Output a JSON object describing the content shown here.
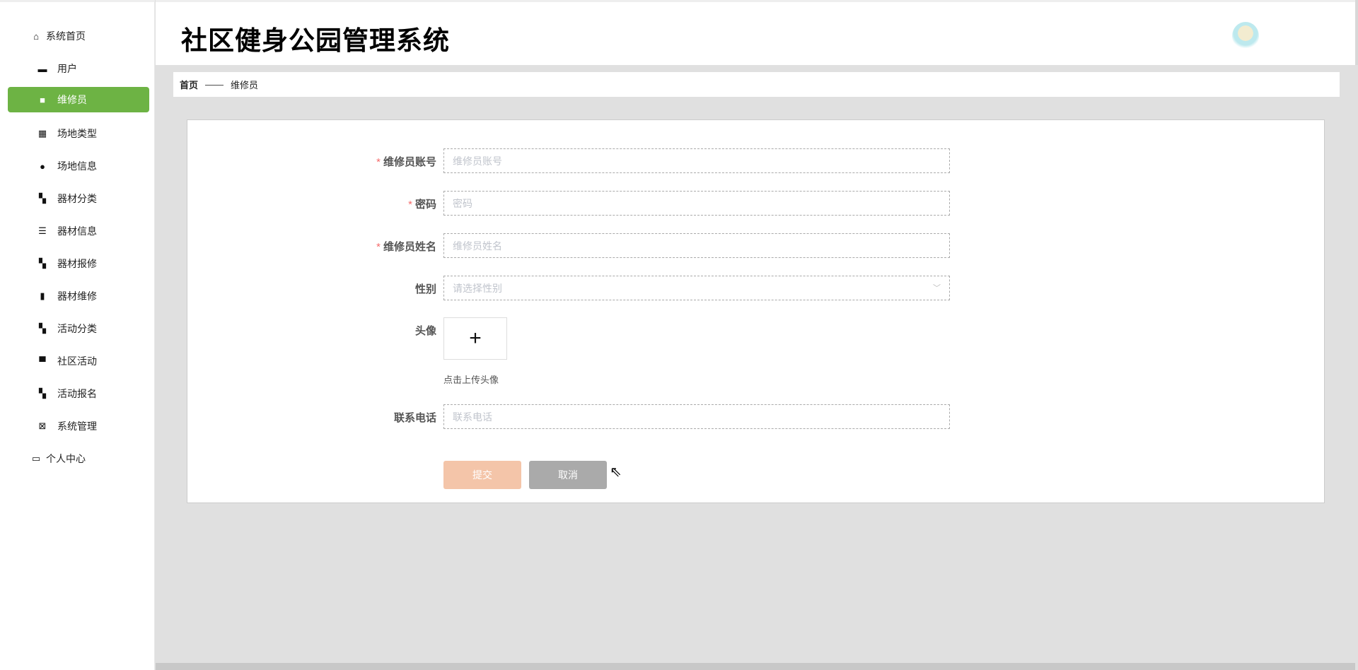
{
  "header": {
    "title": "社区健身公园管理系统"
  },
  "sidebar": {
    "items": [
      {
        "label": "系统首页",
        "icon": "home-icon"
      },
      {
        "label": "用户",
        "icon": "user-icon"
      },
      {
        "label": "维修员",
        "icon": "briefcase-icon"
      },
      {
        "label": "场地类型",
        "icon": "grid-icon"
      },
      {
        "label": "场地信息",
        "icon": "bulb-icon"
      },
      {
        "label": "器材分类",
        "icon": "apps-icon"
      },
      {
        "label": "器材信息",
        "icon": "sliders-icon"
      },
      {
        "label": "器材报修",
        "icon": "apps-icon"
      },
      {
        "label": "器材维修",
        "icon": "bar-chart-icon"
      },
      {
        "label": "活动分类",
        "icon": "apps-icon"
      },
      {
        "label": "社区活动",
        "icon": "comment-icon"
      },
      {
        "label": "活动报名",
        "icon": "apps-icon"
      },
      {
        "label": "系统管理",
        "icon": "clipboard-icon"
      },
      {
        "label": "个人中心",
        "icon": "card-icon"
      }
    ],
    "active": "维修员",
    "accent": "#6db344"
  },
  "breadcrumb": {
    "home": "首页",
    "sep": "——",
    "current": "维修员"
  },
  "form": {
    "account": {
      "label": "维修员账号",
      "placeholder": "维修员账号",
      "required": "*"
    },
    "password": {
      "label": "密码",
      "placeholder": "密码",
      "required": "*"
    },
    "name": {
      "label": "维修员姓名",
      "placeholder": "维修员姓名",
      "required": "*"
    },
    "gender": {
      "label": "性别",
      "placeholder": "请选择性别"
    },
    "avatar": {
      "label": "头像",
      "plus": "+",
      "hint": "点击上传头像"
    },
    "phone": {
      "label": "联系电话",
      "placeholder": "联系电话"
    },
    "submit": "提交",
    "cancel": "取消"
  }
}
